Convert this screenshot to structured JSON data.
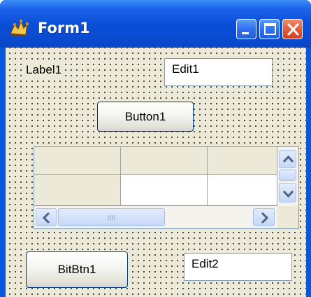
{
  "window": {
    "title": "Form1",
    "icon": "delphi-form-icon",
    "controls": [
      "minimize-icon",
      "maximize-icon",
      "close-icon"
    ]
  },
  "form": {
    "label1": "Label1",
    "edit1": "Edit1",
    "button1": "Button1",
    "bitbtn1": "BitBtn1",
    "edit2": "Edit2"
  },
  "grid": {
    "columns": 3,
    "rows": 2,
    "fixed_cols": 1,
    "fixed_rows": 1,
    "vscroll_icons": [
      "scroll-up-icon",
      "scroll-down-icon"
    ],
    "hscroll_icons": [
      "scroll-left-icon",
      "scroll-right-icon"
    ]
  },
  "colors": {
    "titlebar": "#0a4fd8",
    "face": "#ece9d8",
    "close": "#e25a35"
  }
}
